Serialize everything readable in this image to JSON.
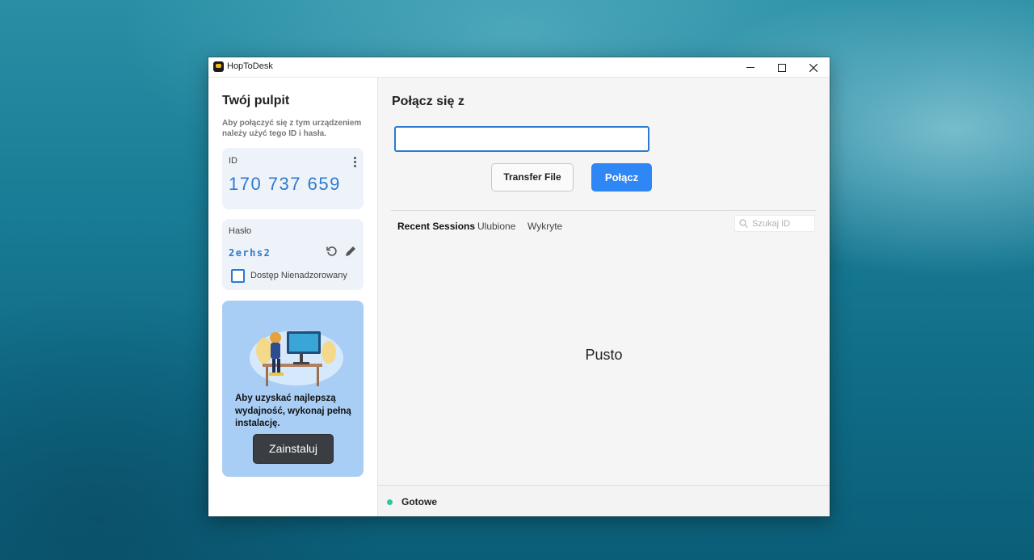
{
  "window": {
    "title": "HopToDesk",
    "controls": {
      "minimize_icon": "minimize-icon",
      "maximize_icon": "maximize-icon",
      "close_icon": "close-icon"
    }
  },
  "sidebar": {
    "title": "Twój pulpit",
    "description": "Aby połączyć się z tym urządzeniem należy użyć tego ID i hasła.",
    "id_card": {
      "label": "ID",
      "value": "170 737 659"
    },
    "password_card": {
      "label": "Hasło",
      "value": "2erhs2",
      "unattended_label": "Dostęp Nienadzorowany",
      "unattended_checked": false
    },
    "promo": {
      "text": "Aby uzyskać najlepszą wydajność, wykonaj pełną instalację.",
      "button_label": "Zainstaluj"
    }
  },
  "main": {
    "title": "Połącz się z",
    "id_input_value": "",
    "transfer_button": "Transfer File",
    "connect_button": "Połącz",
    "tabs": [
      {
        "label": "Recent Sessions",
        "active": true
      },
      {
        "label": "Ulubione",
        "active": false
      },
      {
        "label": "Wykryte",
        "active": false
      }
    ],
    "search_placeholder": "Szukaj ID",
    "empty_text": "Pusto"
  },
  "status": {
    "text": "Gotowe",
    "color": "#2ec4a0"
  },
  "colors": {
    "accent": "#2f86f5",
    "id_text": "#2b7bd0",
    "promo_bg": "#a9cef5"
  }
}
